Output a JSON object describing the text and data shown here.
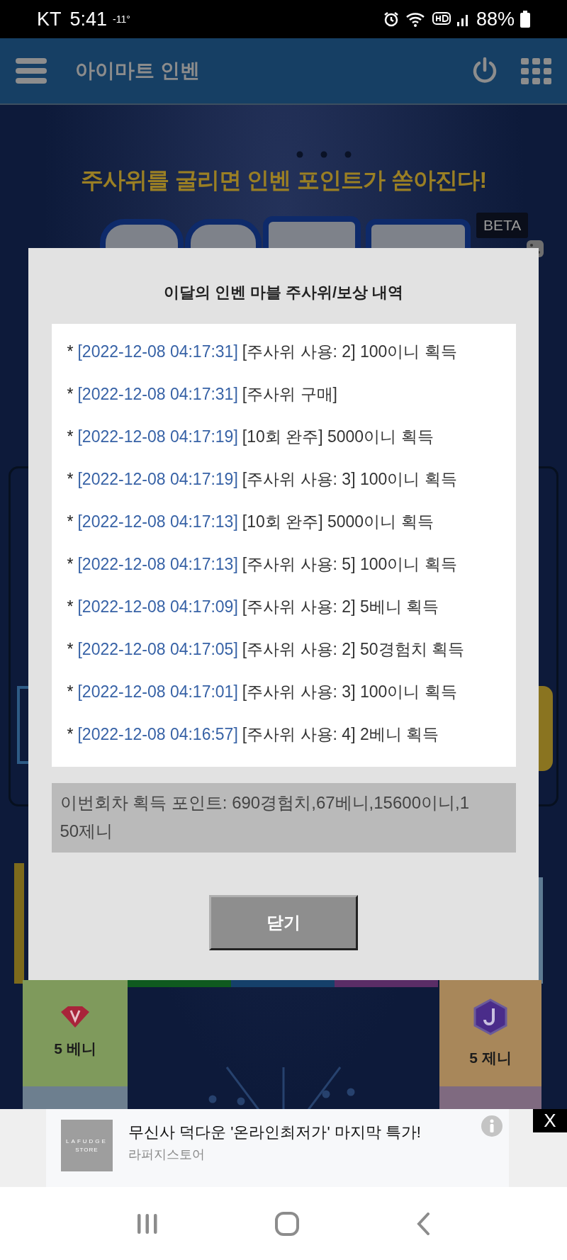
{
  "status_bar": {
    "carrier": "KT",
    "time": "5:41",
    "temperature": "-11°",
    "battery": "88%"
  },
  "header": {
    "title": "아이마트 인벤"
  },
  "banner": {
    "headline": "주사위를 굴리면 인벤 포인트가 쏟아진다!",
    "badge": "BETA"
  },
  "dialog": {
    "title": "이달의 인벤 마블 주사위/보상 내역",
    "entries": [
      {
        "marker": "*",
        "time": "[2022-12-08 04:17:31]",
        "text": "[주사위 사용: 2] 100이니 획득"
      },
      {
        "marker": "*",
        "time": "[2022-12-08 04:17:31]",
        "text": "[주사위 구매]"
      },
      {
        "marker": "*",
        "time": "[2022-12-08 04:17:19]",
        "text": "[10회 완주] 5000이니 획득"
      },
      {
        "marker": "*",
        "time": "[2022-12-08 04:17:19]",
        "text": "[주사위 사용: 3] 100이니 획득"
      },
      {
        "marker": "*",
        "time": "[2022-12-08 04:17:13]",
        "text": "[10회 완주] 5000이니 획득"
      },
      {
        "marker": "*",
        "time": "[2022-12-08 04:17:13]",
        "text": "[주사위 사용: 5] 100이니 획득"
      },
      {
        "marker": "*",
        "time": "[2022-12-08 04:17:09]",
        "text": "[주사위 사용: 2] 5베니 획득"
      },
      {
        "marker": "*",
        "time": "[2022-12-08 04:17:05]",
        "text": "[주사위 사용: 2] 50경험치 획득"
      },
      {
        "marker": "*",
        "time": "[2022-12-08 04:17:01]",
        "text": "[주사위 사용: 3] 100이니 획득"
      },
      {
        "marker": "*",
        "time": "[2022-12-08 04:16:57]",
        "text": "[주사위 사용: 4] 2베니 획득"
      }
    ],
    "summary": "이번회차 획득 포인트: 690경험치,67베니,15600이니,150제니",
    "close_button": "닫기"
  },
  "board_tiles": [
    {
      "label": "5 베니",
      "color": "#7f9a5c"
    },
    {
      "label": "5 제니",
      "color": "#a8875a"
    }
  ],
  "ad": {
    "logo": "LAFUDGE",
    "logo_sub": "STORE",
    "headline": "무신사 덕다운 '온라인최저가' 마지막 특가!",
    "advertiser": "라퍼지스토어",
    "close": "X"
  }
}
